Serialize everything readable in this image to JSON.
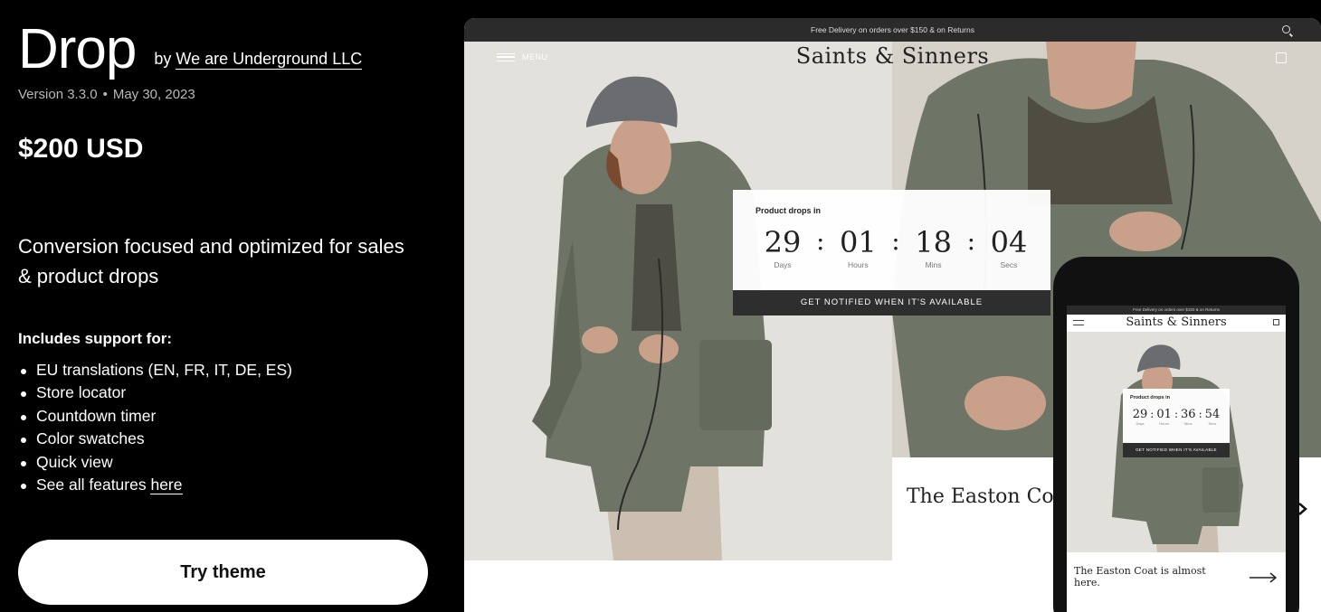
{
  "theme": {
    "name": "Drop",
    "by_prefix": "by",
    "author": "We are Underground LLC",
    "version": "Version 3.3.0",
    "date": "May 30, 2023",
    "price": "$200 USD",
    "tagline": "Conversion focused and optimized for sales & product drops",
    "support_heading": "Includes support for:",
    "features": [
      "EU translations (EN, FR, IT, DE, ES)",
      "Store locator",
      "Countdown timer",
      "Color swatches",
      "Quick view"
    ],
    "see_all_prefix": "See all features ",
    "see_all_link": "here",
    "try_button": "Try theme"
  },
  "preview": {
    "announcement": "Free Delivery on orders over $150 & on Returns",
    "menu_label": "MENU",
    "brand": "Saints & Sinners",
    "countdown": {
      "label": "Product drops in",
      "days": "29",
      "hours": "01",
      "mins": "18",
      "secs": "04",
      "days_cap": "Days",
      "hours_cap": "Hours",
      "mins_cap": "Mins",
      "secs_cap": "Secs",
      "cta": "GET NOTIFIED WHEN IT'S AVAILABLE"
    },
    "caption": "The Easton Coat is almost here."
  },
  "mobile": {
    "announcement": "Free Delivery on orders over $150 & on Returns",
    "brand": "Saints & Sinners",
    "countdown": {
      "label": "Product drops in",
      "days": "29",
      "hours": "01",
      "mins": "36",
      "secs": "54",
      "days_cap": "Days",
      "hours_cap": "Hours",
      "mins_cap": "Mins",
      "secs_cap": "Secs",
      "cta": "GET NOTIFIED WHEN IT'S AVAILABLE"
    },
    "caption": "The Easton Coat is almost here."
  },
  "colors": {
    "background": "#000000",
    "coat": "#6f7566",
    "beanie": "#6a6c6f"
  }
}
